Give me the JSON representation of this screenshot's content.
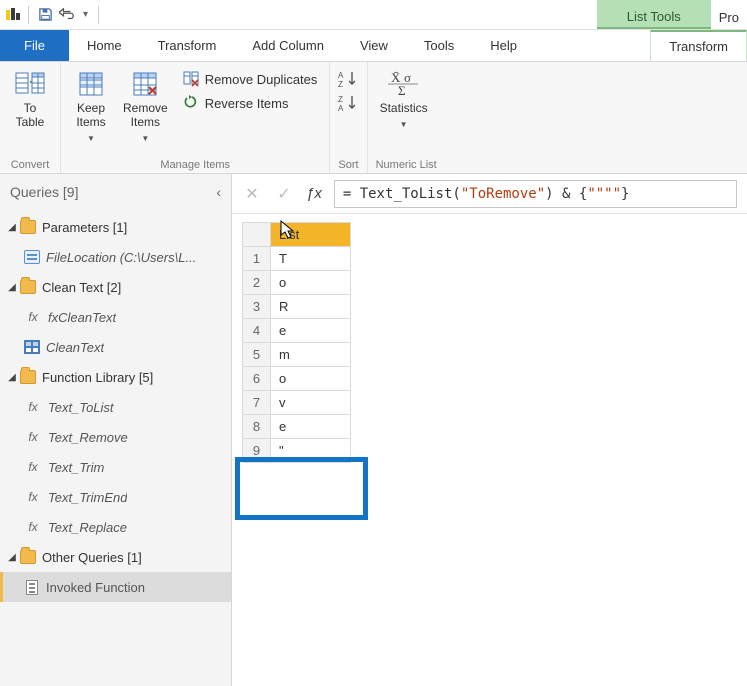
{
  "titlebar": {
    "context_tool_header": "List Tools",
    "truncated_tab": "Pro"
  },
  "tabs": {
    "file": "File",
    "home": "Home",
    "transform": "Transform",
    "add_column": "Add Column",
    "view": "View",
    "tools": "Tools",
    "help": "Help",
    "context_transform": "Transform"
  },
  "ribbon": {
    "convert": {
      "group_label": "Convert",
      "to_table": "To\nTable"
    },
    "manage": {
      "group_label": "Manage Items",
      "keep_items": "Keep\nItems",
      "remove_items": "Remove\nItems",
      "remove_dup": "Remove Duplicates",
      "reverse": "Reverse Items"
    },
    "sort": {
      "group_label": "Sort"
    },
    "numeric": {
      "group_label": "Numeric List",
      "statistics": "Statistics"
    }
  },
  "queries": {
    "title": "Queries [9]",
    "groups": [
      {
        "label": "Parameters [1]",
        "items": [
          {
            "icon": "param",
            "label": "FileLocation (C:\\Users\\L...",
            "italic": true
          }
        ]
      },
      {
        "label": "Clean Text [2]",
        "items": [
          {
            "icon": "fx",
            "label": "fxCleanText",
            "italic": true
          },
          {
            "icon": "table",
            "label": "CleanText",
            "italic": true
          }
        ]
      },
      {
        "label": "Function Library [5]",
        "items": [
          {
            "icon": "fx",
            "label": "Text_ToList",
            "italic": true
          },
          {
            "icon": "fx",
            "label": "Text_Remove",
            "italic": true
          },
          {
            "icon": "fx",
            "label": "Text_Trim",
            "italic": true
          },
          {
            "icon": "fx",
            "label": "Text_TrimEnd",
            "italic": true
          },
          {
            "icon": "fx",
            "label": "Text_Replace",
            "italic": true
          }
        ]
      },
      {
        "label": "Other Queries [1]",
        "items": [
          {
            "icon": "list",
            "label": "Invoked Function",
            "italic": false,
            "selected": true
          }
        ]
      }
    ]
  },
  "formula": {
    "fn_prefix": "= ",
    "fn_name": "Text_ToList",
    "open": "(",
    "arg_str": "\"ToRemove\"",
    "close": ") & {",
    "tail_str": "\"\"\"\"",
    "end": "}"
  },
  "grid": {
    "col_header": "List",
    "rows": [
      {
        "n": "1",
        "v": "T"
      },
      {
        "n": "2",
        "v": "o"
      },
      {
        "n": "3",
        "v": "R"
      },
      {
        "n": "4",
        "v": "e"
      },
      {
        "n": "5",
        "v": "m"
      },
      {
        "n": "6",
        "v": "o"
      },
      {
        "n": "7",
        "v": "v"
      },
      {
        "n": "8",
        "v": "e"
      },
      {
        "n": "9",
        "v": "\""
      }
    ]
  }
}
